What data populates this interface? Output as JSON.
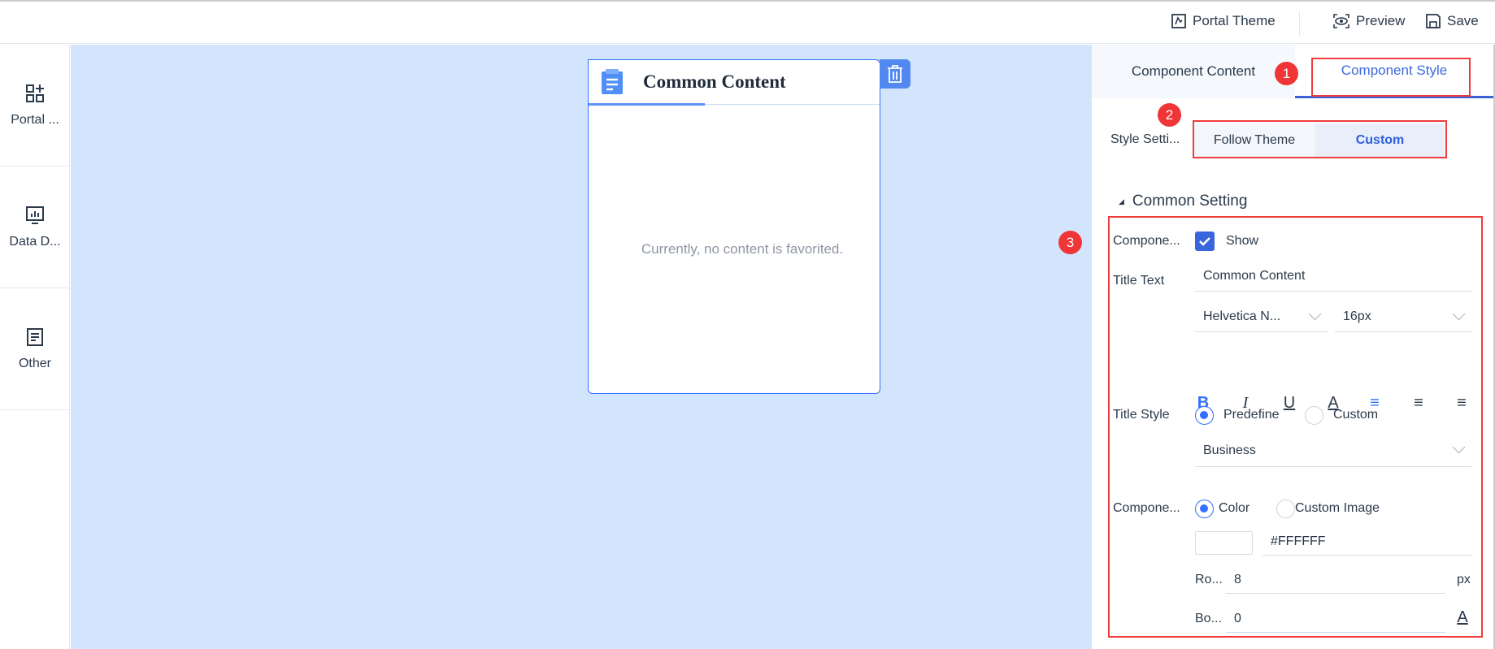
{
  "topbar": {
    "portal_theme": "Portal Theme",
    "preview": "Preview",
    "save": "Save"
  },
  "sidebar": {
    "items": [
      {
        "label": "Portal ...",
        "icon": "add-grid-icon"
      },
      {
        "label": "Data D...",
        "icon": "chart-monitor-icon"
      },
      {
        "label": "Other",
        "icon": "document-icon"
      }
    ]
  },
  "card": {
    "title": "Common Content",
    "empty_text": "Currently, no content is favorited."
  },
  "panel": {
    "tabs": [
      "Component Content",
      "Component Style"
    ],
    "active_tab": "Component Style",
    "badges": [
      "1",
      "2",
      "3"
    ],
    "style_setting_label": "Style Setti...",
    "style_options": [
      "Follow Theme",
      "Custom"
    ],
    "style_selected": "Custom",
    "section_title": "Common Setting",
    "component_title_label": "Compone...",
    "show_label": "Show",
    "show_checked": true,
    "title_text_label": "Title Text",
    "title_text_value": "Common Content",
    "font_family": "Helvetica N...",
    "font_size": "16px",
    "title_style_label": "Title Style",
    "title_style_options": [
      "Predefine",
      "Custom"
    ],
    "title_style_selected": "Predefine",
    "predefined_style": "Business",
    "background_label": "Compone...",
    "background_options": [
      "Color",
      "Custom Image"
    ],
    "background_selected": "Color",
    "color_value": "#FFFFFF",
    "radius_label": "Ro...",
    "radius_value": "8",
    "radius_unit": "px",
    "border_label": "Bo...",
    "border_value": "0"
  },
  "colors": {
    "accent": "#3370ff",
    "canvas": "#d3e5fd",
    "annotation": "#f03c3c"
  }
}
